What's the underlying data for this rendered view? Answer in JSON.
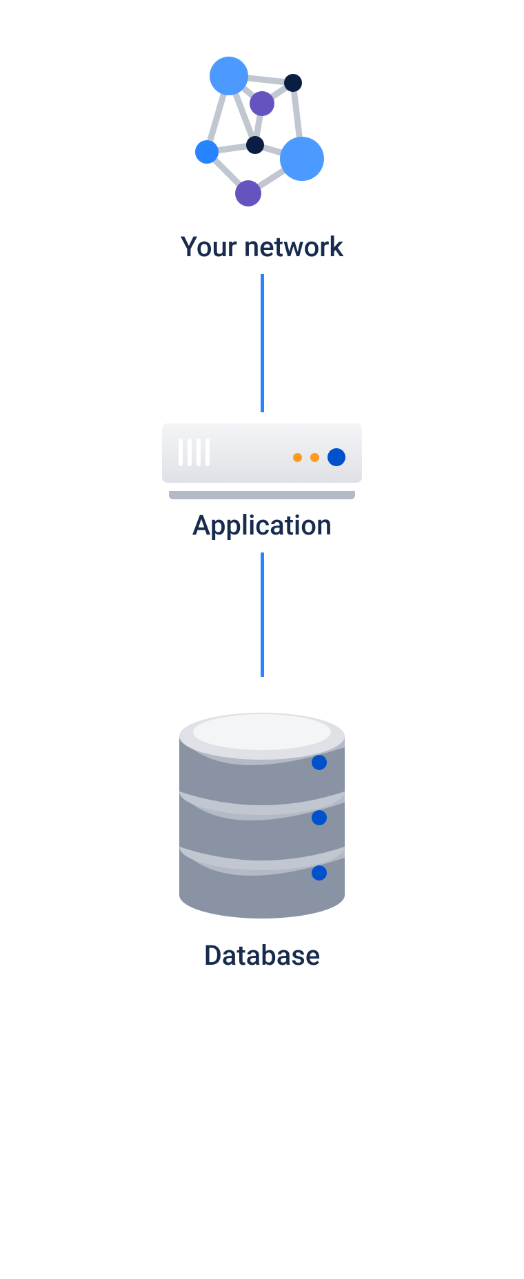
{
  "diagram": {
    "tiers": [
      {
        "label": "Your network",
        "icon": "network-icon"
      },
      {
        "label": "Application",
        "icon": "server-icon"
      },
      {
        "label": "Database",
        "icon": "database-icon"
      }
    ]
  },
  "colors": {
    "label": "#172B4D",
    "connector": "#2684FF",
    "accent_blue": "#0052CC",
    "accent_orange": "#FF991F",
    "purple": "#6554C0",
    "navy": "#091E42",
    "gray_light": "#DFE1E6",
    "gray_mid": "#B3BAC5",
    "gray_dark": "#8993A4"
  }
}
